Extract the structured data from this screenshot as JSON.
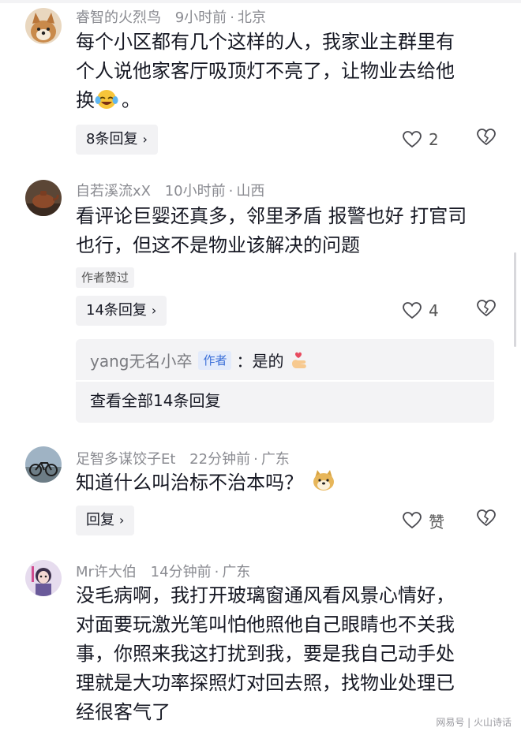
{
  "comments": [
    {
      "user": "睿智的火烈鸟",
      "time": "9小时前",
      "location": "北京",
      "text_lines": [
        "每个小区都有几个这样的人，我家业主群里有",
        "个人说他家客厅吸顶灯不亮了，让物业去给他",
        "换"
      ],
      "text_tail": "。",
      "reply_label": "8条回复",
      "likes": "2"
    },
    {
      "user": "自若溪流xX",
      "time": "10小时前",
      "location": "山西",
      "text_lines": [
        "看评论巨婴还真多，邻里矛盾 报警也好 打官司",
        "也行，但这不是物业该解决的问题"
      ],
      "author_liked": "作者赞过",
      "reply_label": "14条回复",
      "likes": "4",
      "sub_reply": {
        "user": "yang无名小卒",
        "tag": "作者",
        "text": "：是的",
        "view_all": "查看全部14条回复"
      }
    },
    {
      "user": "足智多谋饺子Et",
      "time": "22分钟前",
      "location": "广东",
      "text_lines": [
        "知道什么叫治标不治本吗？"
      ],
      "reply_label": "回复",
      "likes": "赞"
    },
    {
      "user": "Mr许大伯",
      "time": "14分钟前",
      "location": "广东",
      "text_lines": [
        "没毛病啊，我打开玻璃窗通风看风景心情好，",
        "对面要玩激光笔叫怕他照他自己眼睛也不关我",
        "事，你照来我这打扰到我，要是我自己动手处",
        "理就是大功率探照灯对回去照，找物业处理已",
        "经很客气了"
      ]
    }
  ],
  "icons": {
    "like": "heart-outline-icon",
    "dislike": "broken-heart-icon",
    "chevron": "chevron-right-icon"
  },
  "watermark": "网易号 | 火山诗话",
  "colors": {
    "author_tag_text": "#3b6fd8",
    "author_tag_bg": "#e3ebfb",
    "meta": "#8a8b91"
  }
}
